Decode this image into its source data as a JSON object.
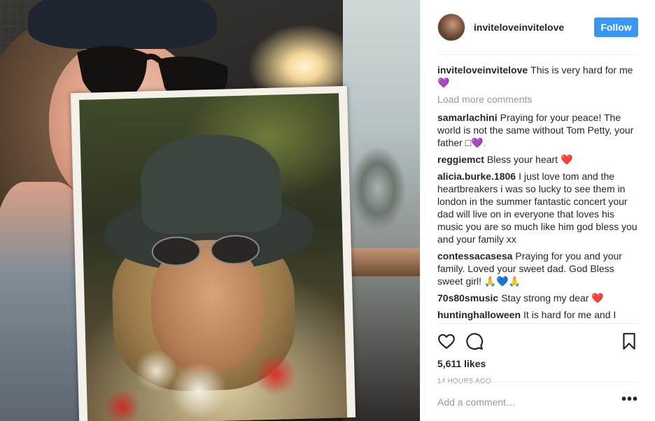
{
  "post": {
    "username": "inviteloveinvitelove",
    "follow_label": "Follow"
  },
  "caption": {
    "user": "inviteloveinvitelove",
    "text": "This is very hard for me",
    "emoji": "💜"
  },
  "load_more": "Load more comments",
  "comments": [
    {
      "user": "samarlachini",
      "text": "Praying for your peace! The world is not the same without Tom Petty, your father",
      "emoji_box": "□",
      "emoji": "💜."
    },
    {
      "user": "reggiemct",
      "text": "Bless your heart",
      "emoji": "❤️"
    },
    {
      "user": "alicia.burke.1806",
      "text": "I just love tom and the heartbreakers i was so lucky to see them in london in the summer fantastic concert your dad will live on in everyone that loves his music you are so much like him god bless you and your family xx"
    },
    {
      "user": "contessacasesa",
      "text": "Praying for you and your family. Loved your sweet dad. God Bless sweet girl!",
      "emoji_a": "🙏",
      "emoji_b": "💙",
      "emoji_c": "🙏"
    },
    {
      "user": "70s80smusic",
      "text": "Stay strong my dear",
      "emoji": "❤️"
    },
    {
      "user": "huntinghalloween",
      "text": "It is hard for me and I"
    }
  ],
  "likes": "5,611 likes",
  "timestamp": "14 HOURS AGO",
  "add_comment": {
    "placeholder": "Add a comment…"
  },
  "more_icon": "•••",
  "icons": [
    "heart-icon",
    "comment-icon",
    "bookmark-icon",
    "more-options-icon"
  ],
  "colors": {
    "accent": "#3897f0",
    "muted": "#999999",
    "text": "#262626",
    "divider": "#efefef"
  }
}
